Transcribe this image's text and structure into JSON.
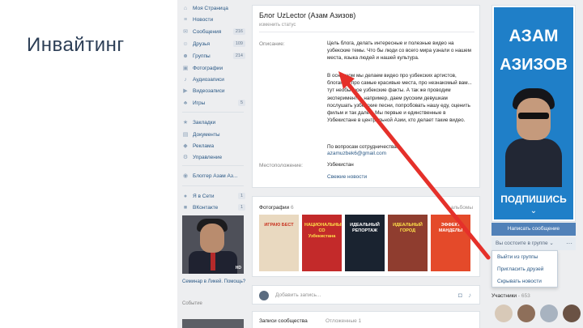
{
  "slide": {
    "title": "Инвайтинг"
  },
  "left_nav": {
    "items": [
      {
        "label": "Моя Страница",
        "icon": "home-icon",
        "count": ""
      },
      {
        "label": "Новости",
        "icon": "news-icon",
        "count": ""
      },
      {
        "label": "Сообщения",
        "icon": "messages-icon",
        "count": "216"
      },
      {
        "label": "Друзья",
        "icon": "friends-icon",
        "count": "109"
      },
      {
        "label": "Группы",
        "icon": "groups-icon",
        "count": "214"
      },
      {
        "label": "Фотографии",
        "icon": "photos-icon",
        "count": ""
      },
      {
        "label": "Аудиозаписи",
        "icon": "music-icon",
        "count": ""
      },
      {
        "label": "Видеозаписи",
        "icon": "video-icon",
        "count": ""
      },
      {
        "label": "Игры",
        "icon": "games-icon",
        "count": "5"
      },
      {
        "label": "Закладки",
        "icon": "bookmarks-icon",
        "count": ""
      },
      {
        "label": "Документы",
        "icon": "documents-icon",
        "count": ""
      },
      {
        "label": "Реклама",
        "icon": "ads-icon",
        "count": ""
      },
      {
        "label": "Управление",
        "icon": "manage-icon",
        "count": ""
      },
      {
        "label": "Блоггер Азам Аз...",
        "icon": "blogger-icon",
        "count": ""
      },
      {
        "label": "Я в Сети",
        "icon": "online-icon",
        "count": "1"
      },
      {
        "label": "ВКонтакте",
        "icon": "vk-icon",
        "count": "1"
      }
    ],
    "ad_caption": "Семинар в Ликей. Помощь?",
    "ad_sub": "Событие",
    "ad_badge": "HD"
  },
  "group": {
    "title": "Блог UzLector (Азам Азизов)",
    "status": "изменить статус",
    "description_label": "Описание:",
    "description_1": "Цель блога, делать интересные и полезные видео на узбекские темы. Что бы люди со всего мира узнали о нашем места, языка людей и нашей культура.",
    "description_2": "В основном мы делаем видео про узбекских артистов, блоганах, про самые красивые места, про незнакомый вам... тут необычное узбекские факты. А так же проводим эксперименты, например, даем русским девушкам послушать узбекские песни, попробовать нашу еду, оценить фильм и так далее. Мы первые и единственные в Узбекистане в центральной Азии, кто делает такие видео.",
    "description_3": "По вопросам сотрудничества:",
    "email": "azamuzbek6@gmail.com",
    "location_label": "Местоположение:",
    "location": "Узбекистан",
    "news_link": "Свежие новости"
  },
  "photos": {
    "title": "Фотографии",
    "count": "6",
    "albums": "альбомы",
    "thumbs": [
      {
        "text": "ИГРАЮ БЕСТ",
        "bg": "#e9d9c0",
        "fg": "#c8321f"
      },
      {
        "text": "НАЦИОНАЛЬНЫЙ СО Узбекистана",
        "bg": "#c32a2a",
        "fg": "#ffe24a"
      },
      {
        "text": "ИДЕАЛЬНЫЙ РЕПОРТАЖ",
        "bg": "#1a2330",
        "fg": "#ffffff"
      },
      {
        "text": "ИДЕАЛЬНЫЙ ГОРОД",
        "bg": "#8f3d2f",
        "fg": "#ffe24a"
      },
      {
        "text": "ЭФФЕКТ МАНДЕЛЫ",
        "bg": "#e44a2a",
        "fg": "#ffffff"
      }
    ]
  },
  "post": {
    "placeholder": "Добавить запись..."
  },
  "wall": {
    "records": "Записи сообщества",
    "other": "Отложенные 1"
  },
  "sidebar": {
    "banner_name_1": "АЗАМ",
    "banner_name_2": "АЗИЗОВ",
    "banner_cta": "ПОДПИШИСЬ",
    "message_button": "Написать сообщение",
    "member_button": "Вы состоите в группе",
    "menu": [
      "Выйти из группы",
      "Пригласить друзей",
      "Скрывать новости"
    ],
    "members_label": "Участники",
    "members_count": "653"
  },
  "colors": {
    "accent": "#5181b8",
    "arrow": "#e5302a",
    "banner": "#1f7fc8",
    "link": "#2a5885"
  }
}
